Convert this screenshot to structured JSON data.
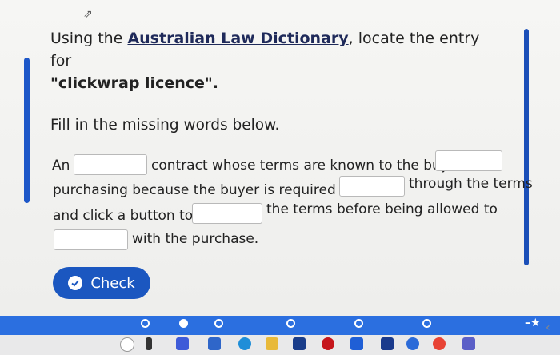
{
  "question": {
    "intro": "Using the ",
    "dictionary_link": "Australian Law Dictionary",
    "middle": ", locate the entry for",
    "term": "\"clickwrap licence\"."
  },
  "instruction": "Fill in the missing words below.",
  "passage": {
    "seg_an": "An",
    "seg_1": "contract whose terms are known to the buyer",
    "seg_2": "purchasing because the buyer is required to",
    "seg_3": "through the terms",
    "seg_4": "and click a button to",
    "seg_5": "the terms before being allowed to",
    "seg_6": "with the purchase."
  },
  "blanks": [
    "",
    "",
    "",
    "",
    "",
    ""
  ],
  "check_button": {
    "label": "Check"
  },
  "colors": {
    "accent": "#1b57c0",
    "progress": "#2b6fe0"
  },
  "taskbar_icons": [
    "search-icon",
    "task-view-icon",
    "chat-icon",
    "store-icon",
    "edge-icon",
    "file-explorer-icon",
    "mail-icon",
    "mcafee-icon",
    "dropbox-icon",
    "app-icon",
    "app-icon-2",
    "chrome-icon",
    "teams-icon"
  ]
}
